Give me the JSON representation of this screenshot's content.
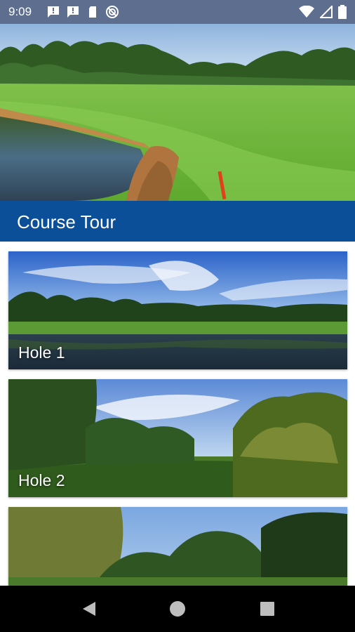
{
  "status_bar": {
    "time": "9:09",
    "notification_icons": [
      "message-alert-icon",
      "message-alert-icon",
      "sd-card-icon",
      "do-not-disturb-icon"
    ],
    "system_icons": [
      "wifi-icon",
      "signal-icon",
      "battery-icon"
    ]
  },
  "hero": {
    "image": "golf-course-pond-photo"
  },
  "section": {
    "title": "Course Tour"
  },
  "holes": [
    {
      "label": "Hole 1",
      "image": "hole-1-lake-photo"
    },
    {
      "label": "Hole 2",
      "image": "hole-2-fairway-photo"
    },
    {
      "label": "",
      "image": "hole-3-trees-photo"
    }
  ],
  "nav": {
    "buttons": [
      "back-icon",
      "home-icon",
      "recents-icon"
    ]
  },
  "colors": {
    "header": "#0a4f98",
    "status_bar": "#5d6e8e",
    "nav_bar": "#000000"
  }
}
